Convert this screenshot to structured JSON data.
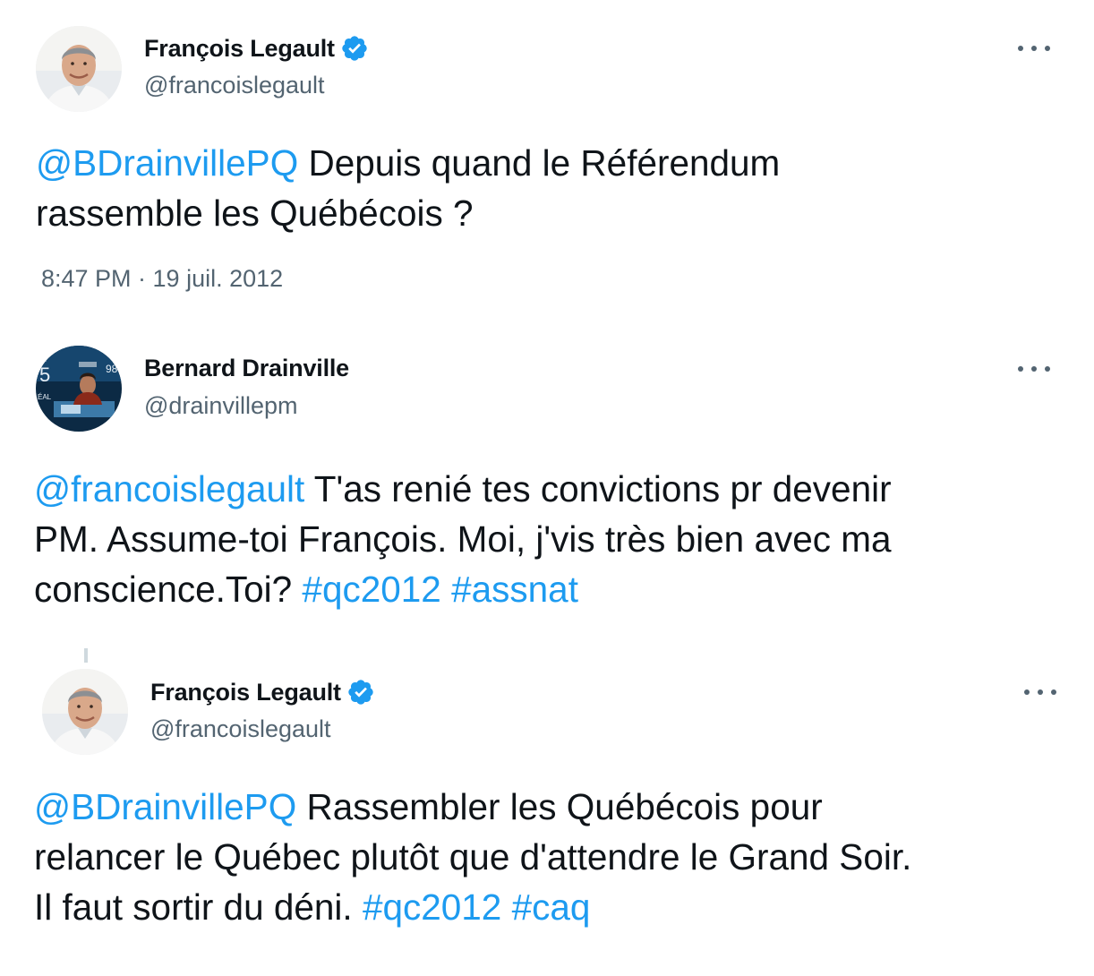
{
  "tweets": [
    {
      "author": {
        "name": "François Legault",
        "handle": "@francoislegault",
        "verified": true
      },
      "body": [
        {
          "text": "@BDrainvillePQ",
          "kind": "mention"
        },
        {
          "text": " Depuis quand le Référendum",
          "kind": "text"
        },
        {
          "text": "rassemble les Québécois ?",
          "kind": "text"
        }
      ],
      "timestamp": "8:47 PM · 19 juil. 2012"
    },
    {
      "author": {
        "name": "Bernard Drainville",
        "handle": "@drainvillepm",
        "verified": false
      },
      "body": [
        {
          "text": "@francoislegault",
          "kind": "mention"
        },
        {
          "text": " T'as renié tes convictions pr devenir",
          "kind": "text"
        },
        {
          "text": "PM. Assume-toi François. Moi, j'vis très bien avec ma",
          "kind": "text"
        },
        {
          "text": "conscience.Toi? ",
          "kind": "text"
        },
        {
          "text": "#qc2012",
          "kind": "hashtag"
        },
        {
          "text": "#assnat",
          "kind": "hashtag"
        }
      ]
    },
    {
      "author": {
        "name": "François Legault",
        "handle": "@francoislegault",
        "verified": true
      },
      "body": [
        {
          "text": "@BDrainvillePQ",
          "kind": "mention"
        },
        {
          "text": " Rassembler les Québécois pour",
          "kind": "text"
        },
        {
          "text": "relancer le Québec plutôt que d'attendre le Grand Soir.",
          "kind": "text"
        },
        {
          "text": "Il faut sortir du déni. ",
          "kind": "text"
        },
        {
          "text": "#qc2012",
          "kind": "hashtag"
        },
        {
          "text": "#caq",
          "kind": "hashtag"
        }
      ]
    }
  ],
  "colors": {
    "link": "#1d9bf0",
    "text": "#0f1419",
    "secondary": "#536471",
    "verified": "#1d9bf0"
  },
  "icons": {
    "verified": "verified-badge-icon",
    "more": "more-options-icon"
  }
}
